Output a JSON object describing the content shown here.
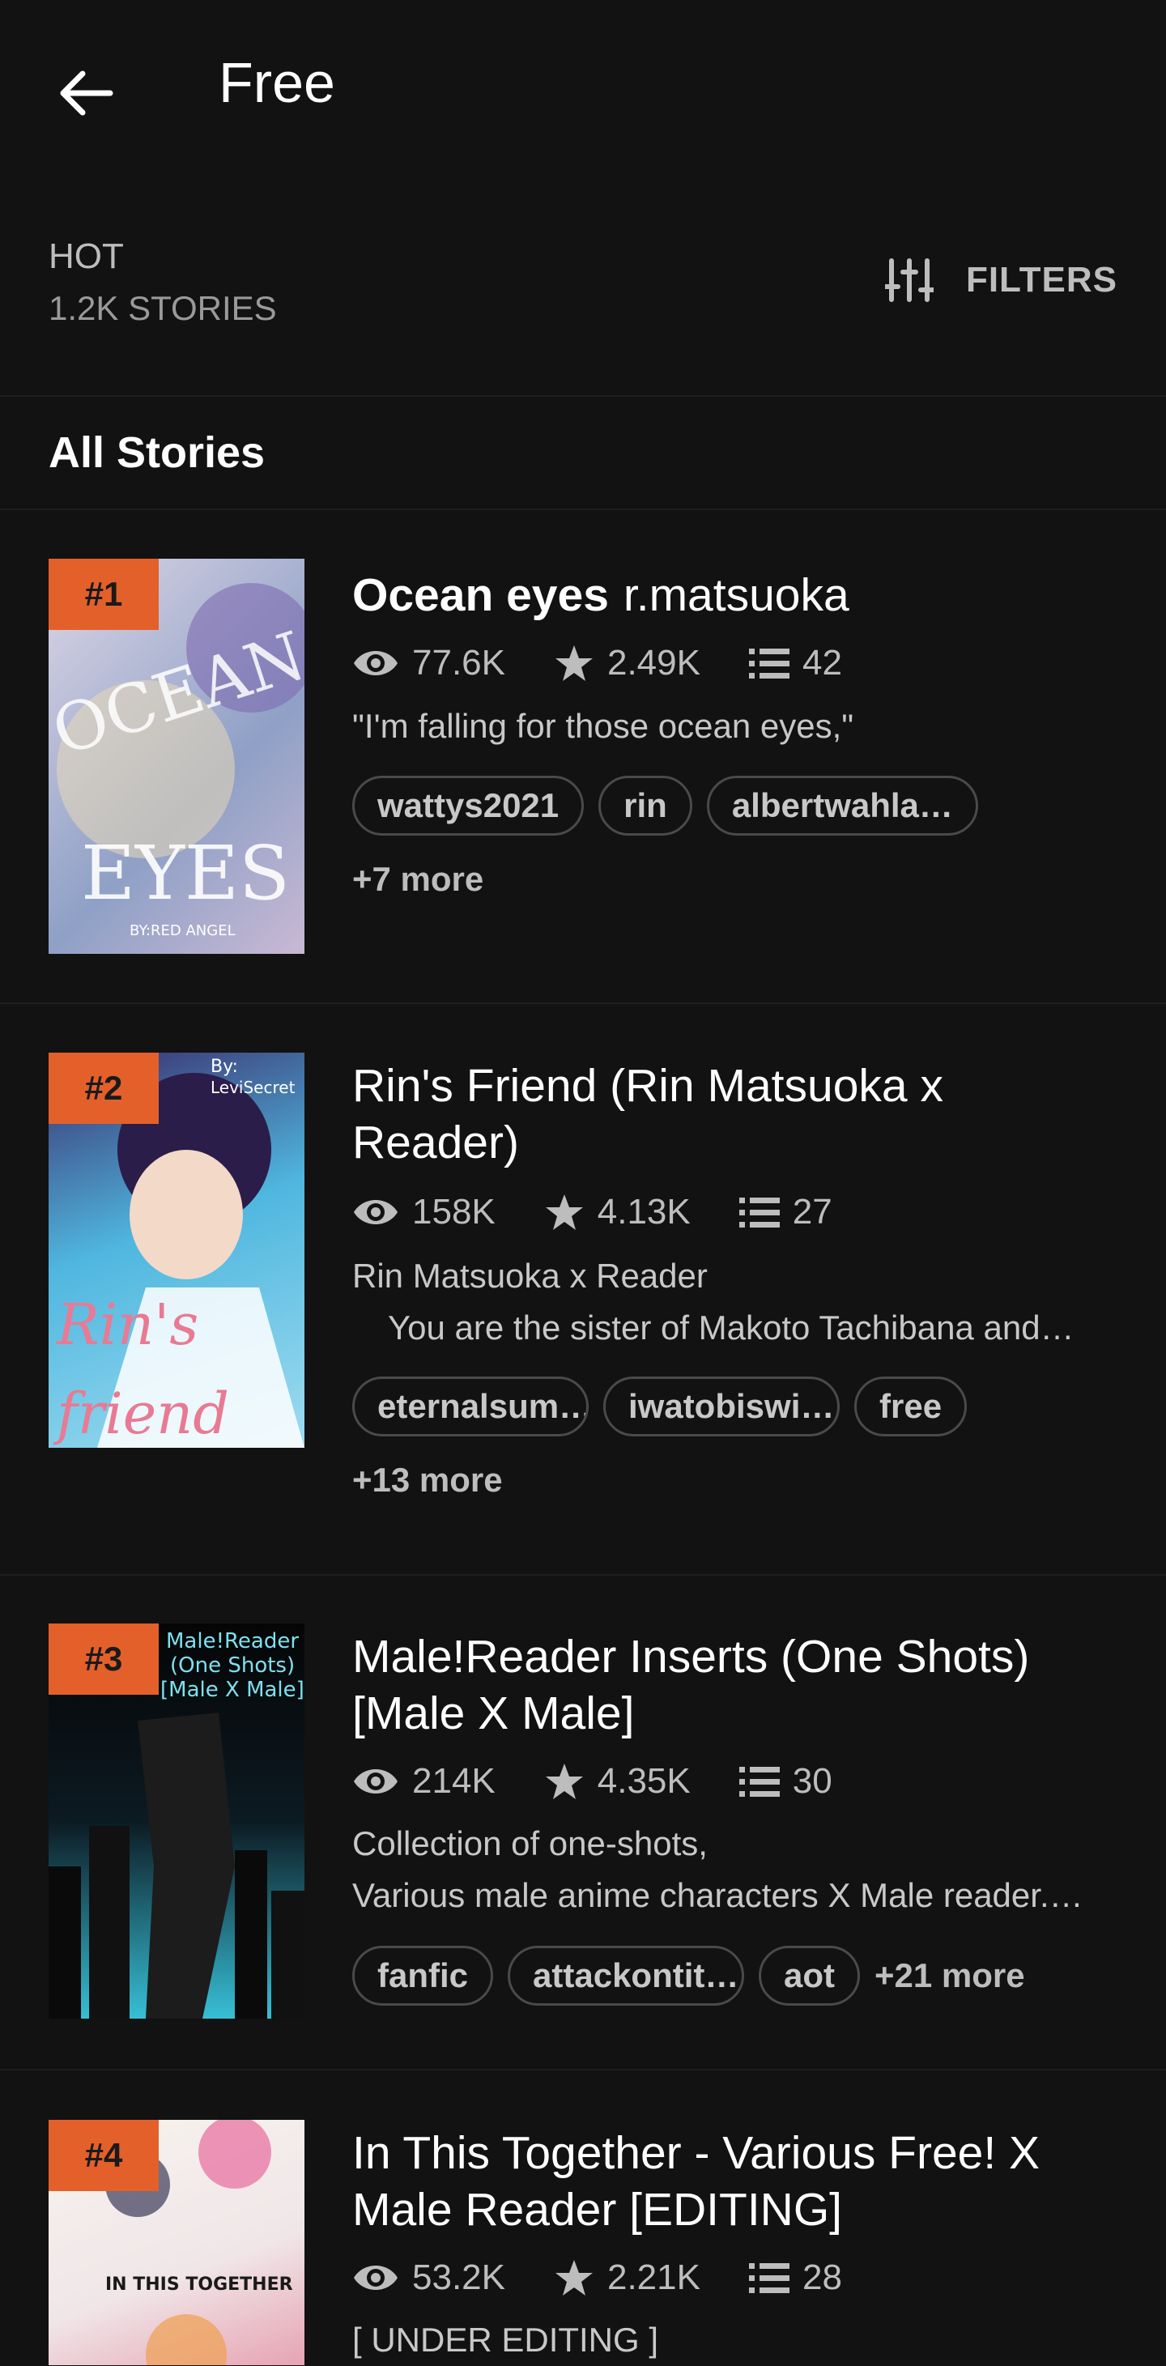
{
  "header": {
    "title": "Free"
  },
  "sort": {
    "label": "HOT",
    "count": "1.2K STORIES",
    "filters_label": "FILTERS"
  },
  "section_title": "All Stories",
  "stories": [
    {
      "rank": "#1",
      "title": "Ocean eyes",
      "author": "r.matsuoka",
      "reads": "77.6K",
      "votes": "2.49K",
      "parts": "42",
      "desc1": "\"I'm falling for those ocean eyes,\"",
      "tags": [
        "wattys2021",
        "rin",
        "albertwahla…"
      ],
      "more": "+7 more",
      "cover_text": "OCEAN EYES",
      "cover_sub": "BY:RED ANGEL",
      "cover_colors": [
        "#c9c3d6",
        "#9aa6c8"
      ]
    },
    {
      "rank": "#2",
      "title": "Rin's Friend (Rin Matsuoka x Reader)",
      "reads": "158K",
      "votes": "4.13K",
      "parts": "27",
      "desc1": "Rin Matsuoka x Reader",
      "desc2": "You are the sister of Makoto Tachibana and…",
      "tags": [
        "eternalsum…",
        "iwatobiswi…",
        "free"
      ],
      "more": "+13 more",
      "cover_text": "Rin's friend",
      "cover_sub": "By: LeviSecret",
      "cover_colors": [
        "#4fb7df",
        "#2a1d4a"
      ]
    },
    {
      "rank": "#3",
      "title": "Male!Reader Inserts (One Shots) [Male X Male]",
      "reads": "214K",
      "votes": "4.35K",
      "parts": "30",
      "desc1": "Collection of one-shots,",
      "desc2": "Various male anime characters X Male reader.…",
      "tags": [
        "fanfic",
        "attackontit…",
        "aot"
      ],
      "more": "+21 more",
      "cover_text": "Male!Reader (One Shots) [Male X Male]",
      "cover_colors": [
        "#0a0a0a",
        "#37bfd6"
      ]
    },
    {
      "rank": "#4",
      "title": "In This Together - Various Free! X Male Reader [EDITING]",
      "reads": "53.2K",
      "votes": "2.21K",
      "parts": "28",
      "desc1": "[ UNDER EDITING ]",
      "cover_text": "IN THIS TOGETHER",
      "cover_colors": [
        "#f4f0ea",
        "#e8a2b0"
      ]
    }
  ]
}
